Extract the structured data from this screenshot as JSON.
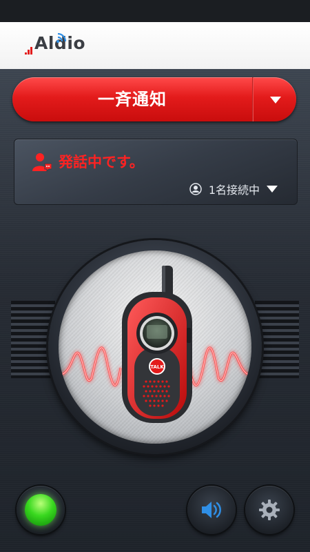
{
  "app": {
    "name": "Aldio"
  },
  "mode_selector": {
    "label": "一斉通知"
  },
  "status": {
    "message": "発話中です。",
    "connection": "1名接続中",
    "message_color": "#ff2222"
  },
  "icons": {
    "logo": "aldio-logo",
    "speaking": "speaking-user-icon",
    "user": "user-icon",
    "dropdown": "chevron-down-icon",
    "talk": "walkie-talkie-icon",
    "led": "status-led-icon",
    "sound": "speaker-icon",
    "settings": "gear-icon"
  },
  "talk_button": {
    "label": "TALK"
  },
  "colors": {
    "accent": "#e31b1b",
    "led": "#39d81f",
    "sound_icon": "#2f8fe6"
  }
}
